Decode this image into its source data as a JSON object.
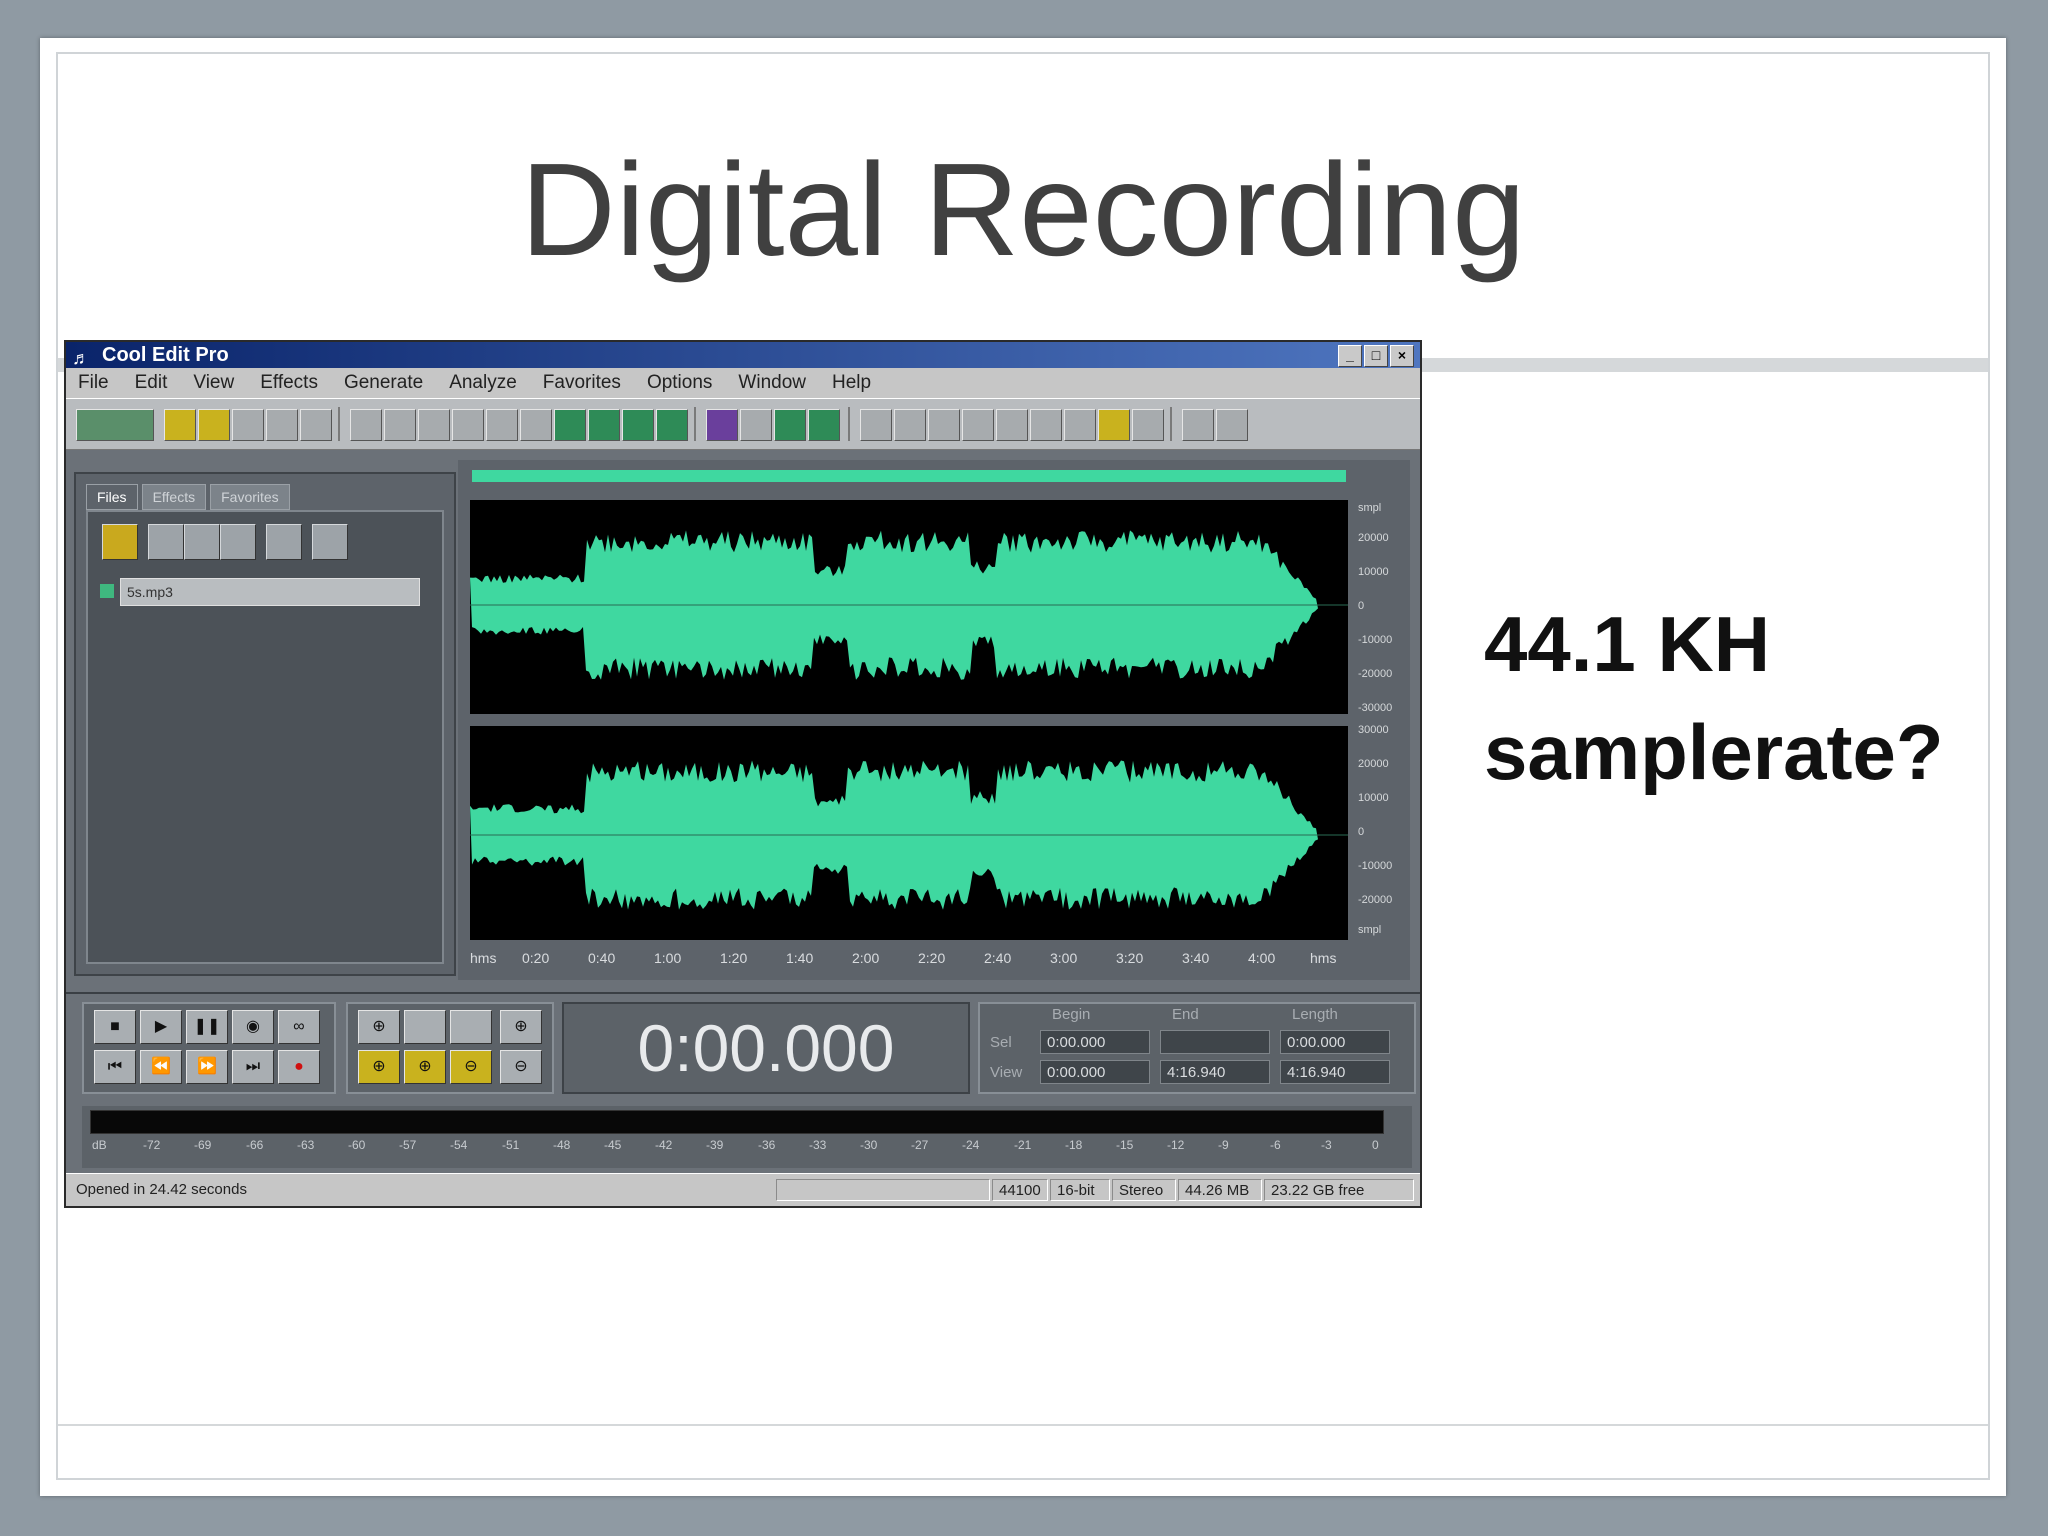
{
  "slide": {
    "title": "Digital Recording",
    "side_text_line1": "44.1 KH",
    "side_text_line2": "samplerate?"
  },
  "app": {
    "window_title": "Cool Edit Pro",
    "menu": [
      "File",
      "Edit",
      "View",
      "Effects",
      "Generate",
      "Analyze",
      "Favorites",
      "Options",
      "Window",
      "Help"
    ],
    "panel_tabs": [
      "Files",
      "Effects",
      "Favorites"
    ],
    "file_item": "5s.mp3",
    "amplitude_labels_top": [
      "smpl",
      "20000",
      "10000",
      "0",
      "-10000",
      "-20000",
      "-30000"
    ],
    "amplitude_labels_bottom": [
      "30000",
      "20000",
      "10000",
      "0",
      "-10000",
      "-20000",
      "smpl"
    ],
    "timeline_labels": [
      "hms",
      "0:20",
      "0:40",
      "1:00",
      "1:20",
      "1:40",
      "2:00",
      "2:20",
      "2:40",
      "3:00",
      "3:20",
      "3:40",
      "4:00",
      "hms"
    ],
    "time_display": "0:00.000",
    "selection": {
      "headers": [
        "Begin",
        "End",
        "Length"
      ],
      "row_labels": [
        "Sel",
        "View"
      ],
      "sel": [
        "0:00.000",
        "",
        "0:00.000"
      ],
      "view": [
        "0:00.000",
        "4:16.940",
        "4:16.940"
      ]
    },
    "meter_ticks": [
      "dB",
      "-72",
      "-69",
      "-66",
      "-63",
      "-60",
      "-57",
      "-54",
      "-51",
      "-48",
      "-45",
      "-42",
      "-39",
      "-36",
      "-33",
      "-30",
      "-27",
      "-24",
      "-21",
      "-18",
      "-15",
      "-12",
      "-9",
      "-6",
      "-3",
      "0"
    ],
    "status": {
      "message": "Opened in 24.42 seconds",
      "sample_rate": "44100",
      "bit_depth": "16-bit",
      "channels": "Stereo",
      "file_size": "44.26 MB",
      "free_space": "23.22 GB free"
    },
    "colors": {
      "waveform": "#3fd8a0",
      "titlebar": "#0a246a",
      "record": "#d01010"
    }
  }
}
